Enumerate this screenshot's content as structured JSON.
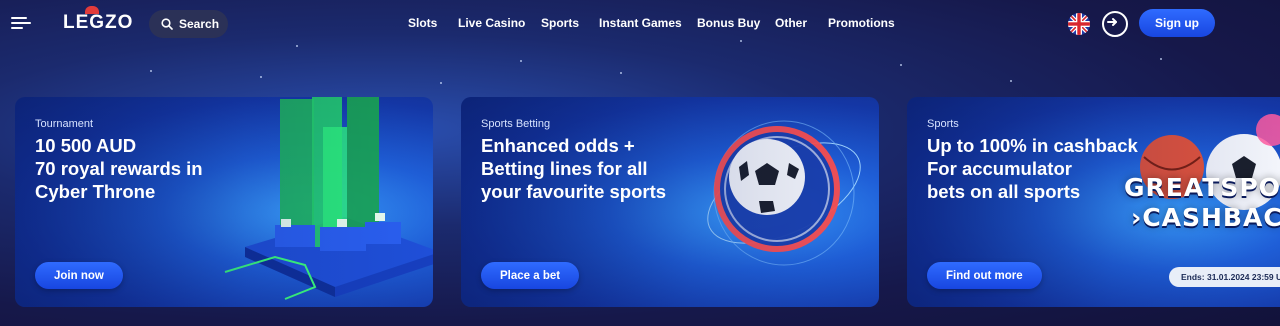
{
  "header": {
    "logo": "LEGZO",
    "search_label": "Search",
    "nav": [
      "Slots",
      "Live Casino",
      "Sports",
      "Instant Games",
      "Bonus Buy",
      "Other",
      "Promotions"
    ],
    "signup_label": "Sign up",
    "icons": {
      "menu": "hamburger-icon",
      "search": "search-icon",
      "language": "uk-flag-icon",
      "login": "login-icon"
    }
  },
  "cards": [
    {
      "label": "Tournament",
      "title_lines": [
        "10 500 AUD",
        "70 royal rewards in",
        "Cyber Throne"
      ],
      "button": "Join now",
      "art": "green-neon-towers"
    },
    {
      "label": "Sports Betting",
      "title_lines": [
        "Enhanced odds +",
        "Betting lines for all",
        "your favourite sports"
      ],
      "button": "Place a bet",
      "art": "soccer-ball-ring"
    },
    {
      "label": "Sports",
      "title_lines": [
        "Up to 100% in cashback",
        "For accumulator",
        "bets on all sports"
      ],
      "button": "Find out more",
      "promo_words": [
        "GREATSPOR",
        "CASHBAC"
      ],
      "ends": "Ends: 31.01.2024 23:59 U"
    }
  ],
  "colors": {
    "accent": "#1f5cf0",
    "background": "#16184a"
  }
}
